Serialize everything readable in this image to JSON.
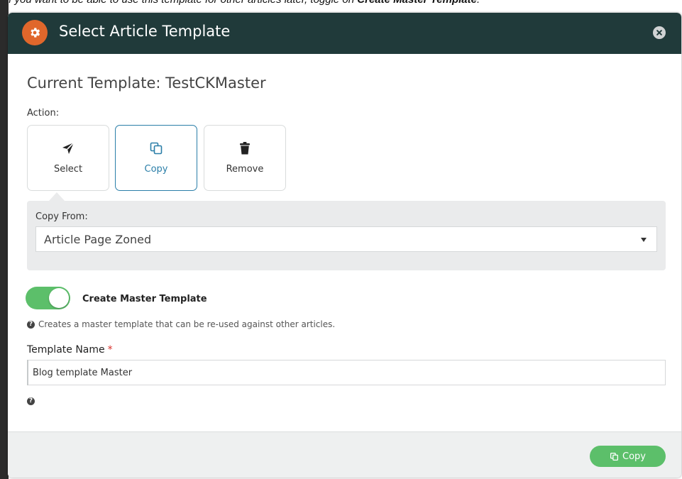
{
  "instruction": {
    "prefix": "If you want to be able to use this template for other articles later, toggle on ",
    "emphasis": "Create Master Template",
    "suffix": "."
  },
  "modal": {
    "title": "Select Article Template",
    "header_icon": "gear-icon",
    "close_icon": "close-circle-icon",
    "current_template": "Current Template: TestCKMaster",
    "action_label": "Action:",
    "actions": [
      {
        "label": "Select",
        "icon": "paper-plane-icon",
        "selected": false
      },
      {
        "label": "Copy",
        "icon": "copy-icon",
        "selected": true
      },
      {
        "label": "Remove",
        "icon": "trash-icon",
        "selected": false
      }
    ],
    "copy_from": {
      "label": "Copy From:",
      "value": "Article Page Zoned"
    },
    "master_toggle": {
      "label": "Create Master Template",
      "on": true,
      "help": "Creates a master template that can be re-used against other articles."
    },
    "template_name": {
      "label": "Template Name",
      "required_mark": "*",
      "value": "Blog template Master"
    },
    "footer": {
      "copy_button_label": "Copy"
    }
  },
  "colors": {
    "header_bg": "#203a3a",
    "accent_orange": "#e0672b",
    "selected_blue": "#2a7ea8",
    "toggle_green": "#5cbf6a",
    "required_red": "#d9302b"
  }
}
